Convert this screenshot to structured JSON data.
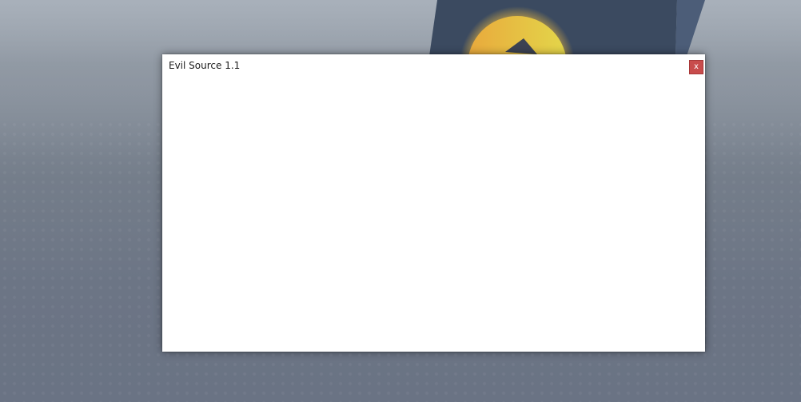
{
  "window": {
    "title": "Evil Source 1.1",
    "close_label": "x",
    "close_icon": "close-icon"
  },
  "colors": {
    "close_button": "#c84c4c",
    "window_background": "#ffffff",
    "title_text": "#1a1a1a"
  }
}
